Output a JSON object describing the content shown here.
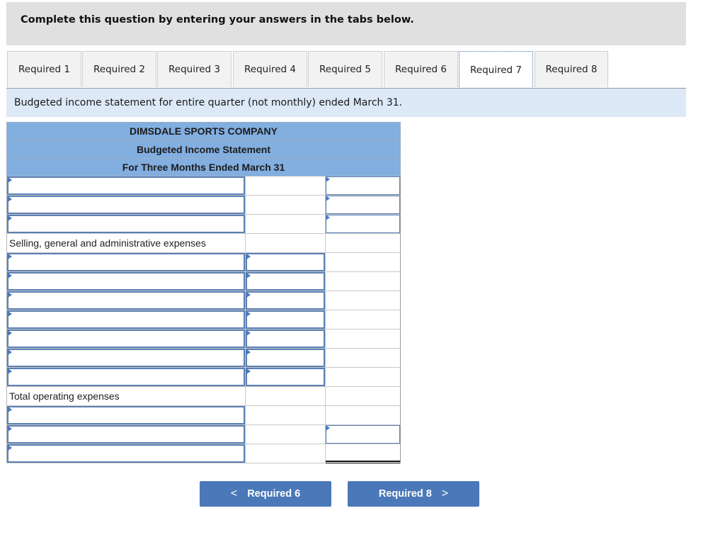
{
  "banner": {
    "text": "Complete this question by entering your answers in the tabs below."
  },
  "tabs": [
    {
      "label": "Required 1",
      "active": false
    },
    {
      "label": "Required 2",
      "active": false
    },
    {
      "label": "Required 3",
      "active": false
    },
    {
      "label": "Required 4",
      "active": false
    },
    {
      "label": "Required 5",
      "active": false
    },
    {
      "label": "Required 6",
      "active": false
    },
    {
      "label": "Required 7",
      "active": true
    },
    {
      "label": "Required 8",
      "active": false
    }
  ],
  "instruction": "Budgeted income statement for entire quarter (not monthly) ended March 31.",
  "statement": {
    "company": "DIMSDALE SPORTS COMPANY",
    "title": "Budgeted Income Statement",
    "period": "For Three Months Ended March 31",
    "rows": [
      {
        "type": "input",
        "label": "",
        "col2": null,
        "col3": ""
      },
      {
        "type": "input",
        "label": "",
        "col2": null,
        "col3": ""
      },
      {
        "type": "input",
        "label": "",
        "col2": null,
        "col3": ""
      },
      {
        "type": "text",
        "label": "Selling, general and administrative expenses"
      },
      {
        "type": "input",
        "label": "",
        "col2": "",
        "col3": null
      },
      {
        "type": "input",
        "label": "",
        "col2": "",
        "col3": null
      },
      {
        "type": "input",
        "label": "",
        "col2": "",
        "col3": null
      },
      {
        "type": "input",
        "label": "",
        "col2": "",
        "col3": null
      },
      {
        "type": "input",
        "label": "",
        "col2": "",
        "col3": null
      },
      {
        "type": "input",
        "label": "",
        "col2": "",
        "col3": null
      },
      {
        "type": "input",
        "label": "",
        "col2": "",
        "col3": null
      },
      {
        "type": "text",
        "label": "Total operating expenses"
      },
      {
        "type": "input",
        "label": "",
        "col2": null,
        "col3": null
      },
      {
        "type": "input",
        "label": "",
        "col2": null,
        "col3": ""
      },
      {
        "type": "input",
        "label": "",
        "col2": null,
        "col3": null,
        "double_underline": true
      }
    ]
  },
  "nav": {
    "prev_label": "Required 6",
    "prev_icon": "chevron-left-icon",
    "next_label": "Required 8",
    "next_icon": "chevron-right-icon",
    "prev_glyph": "<",
    "next_glyph": ">"
  },
  "colors": {
    "banner_bg": "#e0e0e0",
    "instruction_bg": "#dde9f7",
    "header_bg": "#82aee0",
    "input_border": "#5b7fb4",
    "button_bg": "#4a78b8"
  }
}
